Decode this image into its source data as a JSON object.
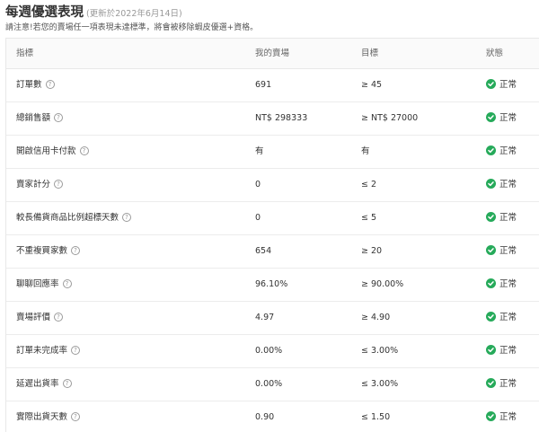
{
  "header": {
    "title": "每週優選表現",
    "updated": "(更新於2022年6月14日)",
    "subtitle": "請注意!若您的賣場任一項表現未達標準，將會被移除蝦皮優選+資格。"
  },
  "table": {
    "columns": [
      "指標",
      "我的賣場",
      "目標",
      "狀態"
    ],
    "rows": [
      {
        "metric": "訂單數",
        "mine": "691",
        "target": "≥ 45",
        "status": "正常"
      },
      {
        "metric": "總銷售額",
        "mine": "NT$ 298333",
        "target": "≥ NT$ 27000",
        "status": "正常"
      },
      {
        "metric": "開啟信用卡付款",
        "mine": "有",
        "target": "有",
        "status": "正常"
      },
      {
        "metric": "賣家計分",
        "mine": "0",
        "target": "≤ 2",
        "status": "正常"
      },
      {
        "metric": "較長備貨商品比例超標天數",
        "mine": "0",
        "target": "≤ 5",
        "status": "正常"
      },
      {
        "metric": "不重複買家數",
        "mine": "654",
        "target": "≥ 20",
        "status": "正常"
      },
      {
        "metric": "聊聊回應率",
        "mine": "96.10%",
        "target": "≥ 90.00%",
        "status": "正常"
      },
      {
        "metric": "賣場評價",
        "mine": "4.97",
        "target": "≥ 4.90",
        "status": "正常"
      },
      {
        "metric": "訂單未完成率",
        "mine": "0.00%",
        "target": "≤ 3.00%",
        "status": "正常"
      },
      {
        "metric": "延遲出貨率",
        "mine": "0.00%",
        "target": "≤ 3.00%",
        "status": "正常"
      },
      {
        "metric": "實際出貨天數",
        "mine": "0.90",
        "target": "≤ 1.50",
        "status": "正常"
      }
    ]
  },
  "icons": {
    "help": "question-circle-icon",
    "status": "check-circle-icon",
    "help_glyph": "?"
  },
  "colors": {
    "status_ok": "#26aa5a",
    "header_bg": "#fafafa",
    "border": "#e8e8e8"
  }
}
